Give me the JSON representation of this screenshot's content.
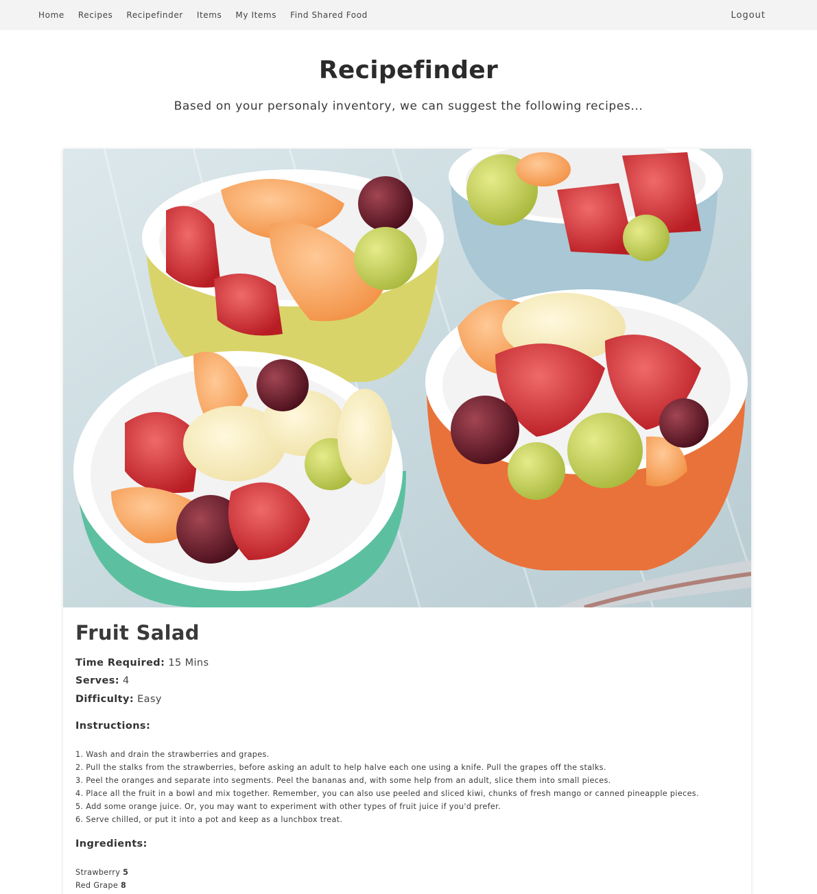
{
  "nav": {
    "items": [
      "Home",
      "Recipes",
      "Recipefinder",
      "Items",
      "My Items",
      "Find Shared Food"
    ],
    "logout": "Logout"
  },
  "header": {
    "title": "Recipefinder",
    "subtitle": "Based on your personaly inventory, we can suggest the following recipes..."
  },
  "recipe": {
    "image_icon": "fruit-salad-photo",
    "title": "Fruit Salad",
    "time_label": "Time Required:",
    "time_value": "15 Mins",
    "serves_label": "Serves:",
    "serves_value": "4",
    "difficulty_label": "Difficulty:",
    "difficulty_value": "Easy",
    "instructions_heading": "Instructions:",
    "instructions": [
      "1. Wash and drain the strawberries and grapes.",
      "2. Pull the stalks from the strawberries, before asking an adult to help halve each one using a knife. Pull the grapes off the stalks.",
      "3. Peel the oranges and separate into segments. Peel the bananas and, with some help from an adult, slice them into small pieces.",
      "4. Place all the fruit in a bowl and mix together. Remember, you can also use peeled and sliced kiwi, chunks of fresh mango or canned pineapple pieces.",
      "5. Add some orange juice. Or, you may want to experiment with other types of fruit juice if you'd prefer.",
      "6. Serve chilled, or put it into a pot and keep as a lunchbox treat."
    ],
    "ingredients_heading": "Ingredients:",
    "ingredients": [
      {
        "name": "Strawberry",
        "qty": "5"
      },
      {
        "name": "Red Grape",
        "qty": "8"
      }
    ]
  }
}
